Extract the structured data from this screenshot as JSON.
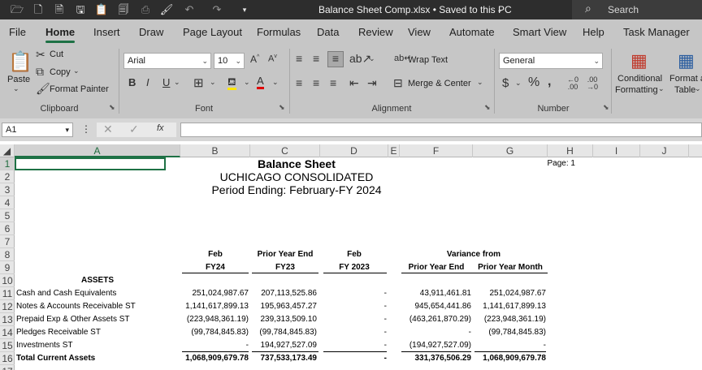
{
  "titlebar": {
    "doc_title": "Balance Sheet Comp.xlsx • Saved to this PC",
    "search_placeholder": "Search",
    "qa_icons": [
      "open-icon",
      "new-icon",
      "save-as-icon",
      "save-icon",
      "paste-icon",
      "print-icon",
      "format-painter-icon",
      "undo-icon",
      "redo-icon",
      "customize-icon"
    ]
  },
  "tabs": [
    "File",
    "Home",
    "Insert",
    "Draw",
    "Page Layout",
    "Formulas",
    "Data",
    "Review",
    "View",
    "Automate",
    "Smart View",
    "Help",
    "Task Manager"
  ],
  "active_tab": "Home",
  "ribbon": {
    "clipboard": {
      "label": "Clipboard",
      "paste": "Paste",
      "cut": "Cut",
      "copy": "Copy",
      "format_painter": "Format Painter"
    },
    "font": {
      "label": "Font",
      "name": "Arial",
      "size": "10"
    },
    "alignment": {
      "label": "Alignment",
      "wrap_text": "Wrap Text",
      "merge_center": "Merge & Center"
    },
    "number": {
      "label": "Number",
      "format": "General"
    },
    "styles": {
      "conditional": "Conditional",
      "formatting": "Formatting",
      "format_as": "Format as",
      "table": "Table"
    }
  },
  "formula_bar": {
    "name_box": "A1",
    "formula": ""
  },
  "columns": [
    "A",
    "B",
    "C",
    "D",
    "E",
    "F",
    "G",
    "H",
    "I",
    "J"
  ],
  "rows": [
    "1",
    "2",
    "3",
    "4",
    "5",
    "6",
    "7",
    "8",
    "9",
    "10",
    "11",
    "12",
    "13",
    "14",
    "15",
    "16",
    "17"
  ],
  "sheet": {
    "title": "Balance Sheet",
    "subtitle": "UCHICAGO CONSOLIDATED",
    "period": "Period Ending: February-FY 2024",
    "page": "Page: 1",
    "headers_row8": {
      "b": "Feb",
      "c": "Prior Year End",
      "d": "Feb",
      "fg": "Variance from"
    },
    "headers_row9": {
      "b": "FY24",
      "c": "FY23",
      "d": "FY 2023",
      "f": "Prior Year End",
      "g": "Prior Year Month"
    },
    "section": "ASSETS",
    "lines": [
      {
        "label": "Cash and Cash Equivalents",
        "b": "251,024,987.67",
        "c": "207,113,525.86",
        "d": "-",
        "f": "43,911,461.81",
        "g": "251,024,987.67",
        "bold": false
      },
      {
        "label": "Notes & Accounts Receivable ST",
        "b": "1,141,617,899.13",
        "c": "195,963,457.27",
        "d": "-",
        "f": "945,654,441.86",
        "g": "1,141,617,899.13",
        "bold": false
      },
      {
        "label": "Prepaid Exp & Other Assets ST",
        "b": "(223,948,361.19)",
        "c": "239,313,509.10",
        "d": "-",
        "f": "(463,261,870.29)",
        "g": "(223,948,361.19)",
        "bold": false
      },
      {
        "label": "Pledges Receivable ST",
        "b": "(99,784,845.83)",
        "c": "(99,784,845.83)",
        "d": "-",
        "f": "-",
        "g": "(99,784,845.83)",
        "bold": false
      },
      {
        "label": "Investments ST",
        "b": "-",
        "c": "194,927,527.09",
        "d": "-",
        "f": "(194,927,527.09)",
        "g": "-",
        "bold": false
      },
      {
        "label": "Total Current Assets",
        "b": "1,068,909,679.78",
        "c": "737,533,173.49",
        "d": "-",
        "f": "331,376,506.29",
        "g": "1,068,909,679.78",
        "bold": true
      }
    ]
  }
}
